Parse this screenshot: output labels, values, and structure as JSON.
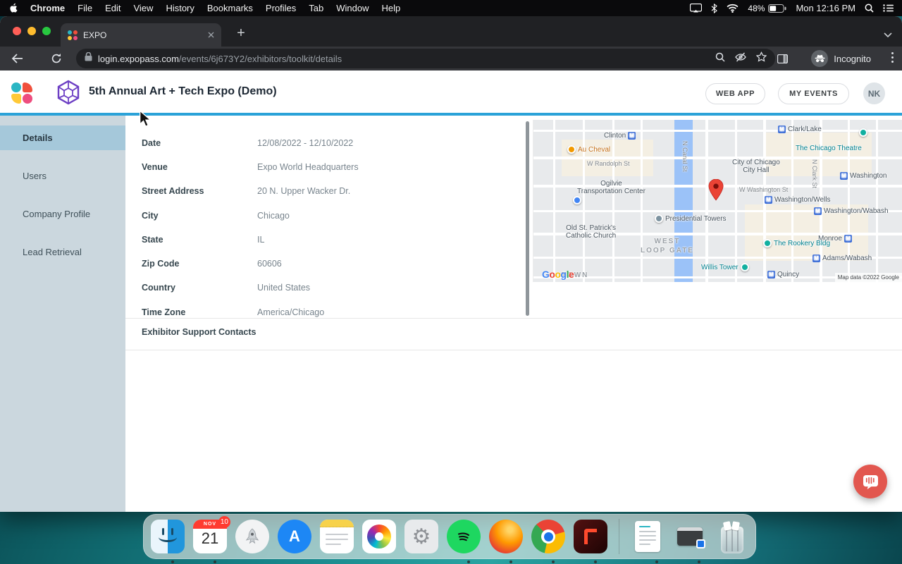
{
  "menubar": {
    "items": [
      "Chrome",
      "File",
      "Edit",
      "View",
      "History",
      "Bookmarks",
      "Profiles",
      "Tab",
      "Window",
      "Help"
    ],
    "battery": "48%",
    "clock": "Mon 12:16 PM"
  },
  "browser": {
    "tab_title": "EXPO",
    "new_tab_label": "+",
    "url_host": "login.expopass.com",
    "url_path": "/events/6j673Y2/exhibitors/toolkit/details",
    "incognito_label": "Incognito"
  },
  "app_header": {
    "title": "5th Annual Art + Tech Expo (Demo)",
    "web_app_button": "WEB APP",
    "my_events_button": "MY EVENTS",
    "avatar_initials": "NK"
  },
  "sidebar": {
    "items": [
      {
        "label": "Details",
        "active": true
      },
      {
        "label": "Users",
        "active": false
      },
      {
        "label": "Company Profile",
        "active": false
      },
      {
        "label": "Lead Retrieval",
        "active": false
      }
    ]
  },
  "details": {
    "rows": [
      {
        "label": "Date",
        "value": "12/08/2022 - 12/10/2022"
      },
      {
        "label": "Venue",
        "value": "Expo World Headquarters"
      },
      {
        "label": "Street Address",
        "value": "20 N. Upper Wacker Dr."
      },
      {
        "label": "City",
        "value": "Chicago"
      },
      {
        "label": "State",
        "value": "IL"
      },
      {
        "label": "Zip Code",
        "value": "60606"
      },
      {
        "label": "Country",
        "value": "United States"
      },
      {
        "label": "Time Zone",
        "value": "America/Chicago"
      }
    ],
    "support_heading": "Exhibitor Support Contacts"
  },
  "map": {
    "labels": {
      "clinton": "Clinton",
      "clark_lake": "Clark/Lake",
      "chicago_theatre": "The Chicago Theatre",
      "au_cheval": "Au Cheval",
      "randolph": "W Randolph St",
      "city_hall_1": "City of Chicago",
      "city_hall_2": "City Hall",
      "washington": "Washington",
      "ogilvie_1": "Ogilvie",
      "ogilvie_2": "Transportation Center",
      "w_washington": "W Washington St",
      "washington_wells": "Washington/Wells",
      "washington_wabash": "Washington/Wabash",
      "presidential_towers": "Presidential Towers",
      "old_st_1": "Old St. Patrick's",
      "old_st_2": "Catholic Church",
      "west_loop_1": "WEST",
      "west_loop_2": "LOOP GATE",
      "monroe": "Monroe",
      "rookery": "The Rookery Bldg",
      "willis": "Willis Tower",
      "quincy": "Quincy",
      "adams_wabash": "Adams/Wabash",
      "canal_st": "N Canal St",
      "clark_st": "N Clark St",
      "town": "TOWN",
      "station_m": "M"
    },
    "google_letters": [
      "G",
      "o",
      "o",
      "g",
      "l",
      "e"
    ],
    "attribution": "Map data ©2022 Google"
  },
  "dock": {
    "items": [
      "finder",
      "calendar",
      "launchpad",
      "app-store",
      "notes",
      "photos",
      "system-preferences",
      "spotify",
      "firefox",
      "chrome",
      "adobe-app",
      "organizer-document",
      "display-utility",
      "trash"
    ],
    "calendar_month": "NOV",
    "calendar_day": "21",
    "calendar_badge": "10"
  },
  "icons": {
    "lock": "padlock",
    "search": "magnifier",
    "eye_off": "eye-with-slash",
    "star": "bookmark-star",
    "incognito": "spy-hat-glasses",
    "kebab": "three-vertical-dots",
    "wifi": "wifi-arcs",
    "bluetooth": "bluetooth-rune",
    "battery": "battery-half"
  },
  "colors": {
    "accent_bar": "#2BA2D8",
    "sidebar_bg": "#CBD7DE",
    "sidebar_active": "#A5C8DA",
    "intercom": "#E2574F",
    "map_pin": "#EA4335",
    "station_blue": "#3367D6",
    "tabstrip_bg": "#202124",
    "toolbar_bg": "#35363A"
  }
}
